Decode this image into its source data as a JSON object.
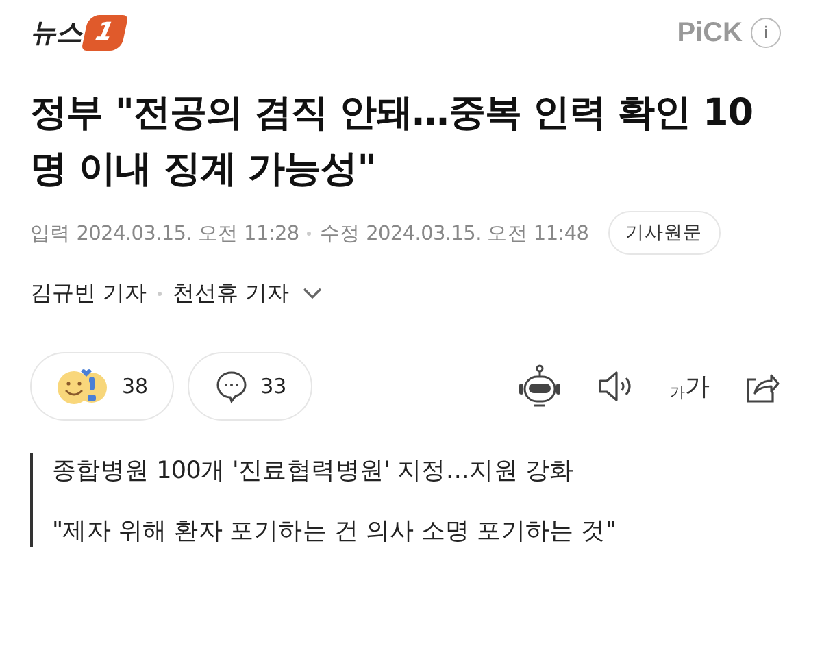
{
  "header": {
    "logo_text": "뉴스",
    "logo_badge": "1",
    "pick": "PiCK",
    "info": "i"
  },
  "headline": "정부 \"전공의 겸직 안돼…중복 인력 확인 10명 이내 징계 가능성\"",
  "meta": {
    "input": "입력",
    "input_time": "2024.03.15. 오전 11:28",
    "modified": "수정",
    "modified_time": "2024.03.15. 오전 11:48",
    "original_button": "기사원문"
  },
  "authors": [
    "김규빈 기자",
    "천선휴 기자"
  ],
  "reactions": {
    "count": "38"
  },
  "comments": {
    "count": "33"
  },
  "font_size_button": {
    "small": "가",
    "large": "가"
  },
  "related": [
    "종합병원 100개 '진료협력병원' 지정…지원 강화",
    "\"제자 위해 환자 포기하는 건 의사 소명 포기하는 것\""
  ]
}
